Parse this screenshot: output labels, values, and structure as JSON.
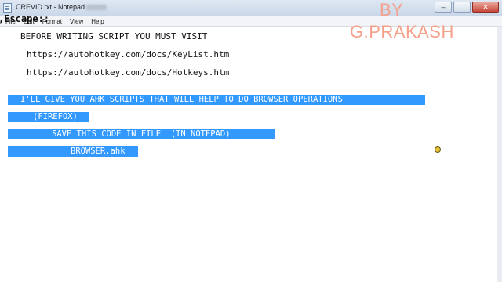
{
  "window": {
    "title": "CREVID.txt - Notepad",
    "buttons": {
      "minimize": "–",
      "maximize": "□",
      "close": "✕"
    }
  },
  "menu": [
    "File",
    "Edit",
    "Format",
    "View",
    "Help"
  ],
  "overlay": {
    "escape_text": ",Escape::",
    "by": "BY",
    "author": "G.PRAKASH"
  },
  "editor": {
    "line1": "BEFORE WRITING SCRIPT YOU MUST VISIT",
    "line2": "https://autohotkey.com/docs/KeyList.htm",
    "line3": "https://autohotkey.com/docs/Hotkeys.htm",
    "selected": [
      "I'LL GIVE YOU AHK SCRIPTS THAT WILL HELP TO DO BROWSER OPERATIONS",
      "(FIREFOX)",
      "SAVE THIS CODE IN FILE  (IN NOTEPAD)",
      "BROWSER.ahk"
    ]
  },
  "colors": {
    "selection": "#3399ff",
    "byline": "#f4a08a"
  }
}
